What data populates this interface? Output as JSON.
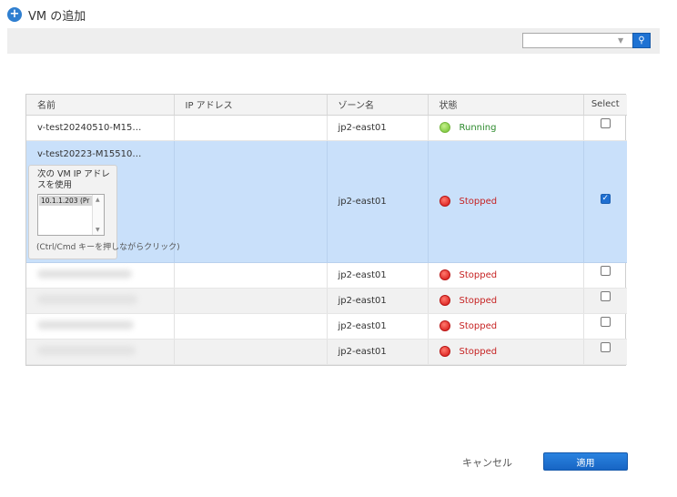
{
  "header": {
    "title": "VM の追加",
    "icon": "plus-circle-icon"
  },
  "search": {
    "placeholder": "",
    "value": "",
    "dropdown_glyph": "▼",
    "icon": "search-icon",
    "button_glyph": "⚲"
  },
  "table": {
    "columns": {
      "name": "名前",
      "ip": "IP アドレス",
      "zone": "ゾーン名",
      "state": "状態",
      "select": "Select"
    },
    "rows": [
      {
        "name": "v-test20240510-M15…",
        "ip": "",
        "zone": "jp2-east01",
        "status": "Running",
        "selected": false
      },
      {
        "name": "v-test20223-M15510…",
        "ip": "",
        "zone": "jp2-east01",
        "status": "Stopped",
        "selected": true
      },
      {
        "name": "",
        "ip": "",
        "zone": "jp2-east01",
        "status": "Stopped",
        "selected": false
      },
      {
        "name": "",
        "ip": "",
        "zone": "jp2-east01",
        "status": "Stopped",
        "selected": false
      },
      {
        "name": "",
        "ip": "",
        "zone": "jp2-east01",
        "status": "Stopped",
        "selected": false
      },
      {
        "name": "",
        "ip": "",
        "zone": "jp2-east01",
        "status": "Stopped",
        "selected": false
      }
    ]
  },
  "ip_popup": {
    "label": "次の VM IP アドレスを使用",
    "options": [
      "10.1.1.203 (Pr"
    ],
    "hint": "(Ctrl/Cmd キーを押しながらクリック)"
  },
  "footer": {
    "cancel_label": "キャンセル",
    "apply_label": "適用"
  },
  "colors": {
    "accent": "#1e72d3",
    "selected_row": "#c9e0fa",
    "running": "#2c8a2c",
    "stopped": "#c62222"
  }
}
